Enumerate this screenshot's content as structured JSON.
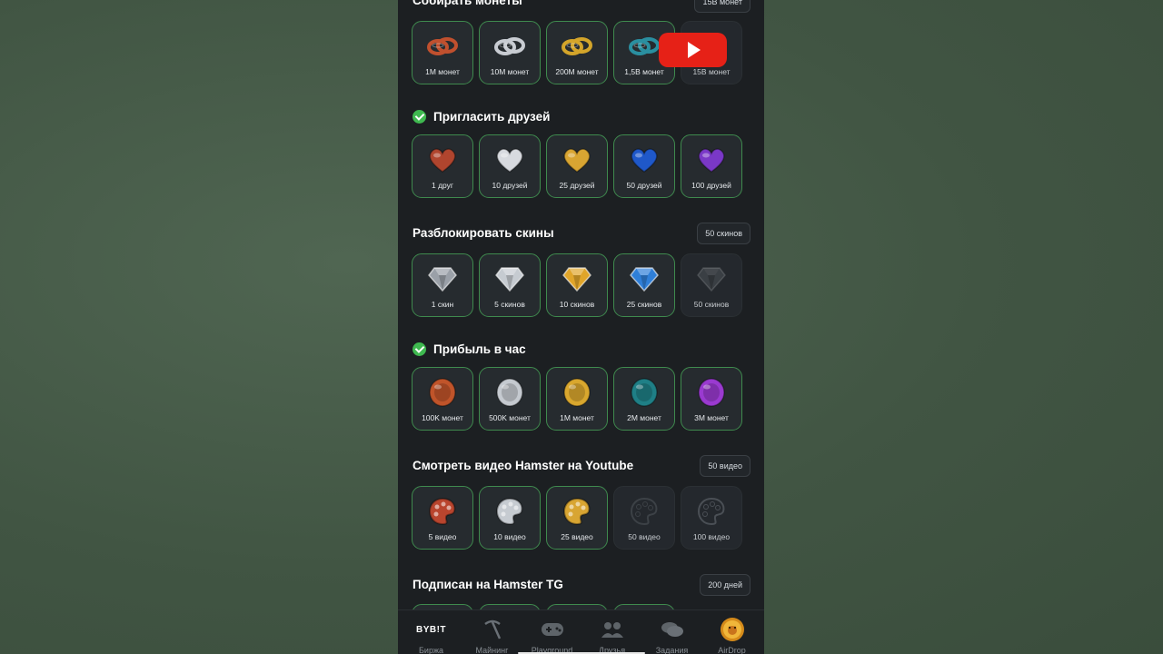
{
  "sections": {
    "coins": {
      "title": "Собирать монеты",
      "badge": "15B монет",
      "items": [
        {
          "label": "1M монет",
          "done": true,
          "color": "#c0502e",
          "icon": "rings-icon"
        },
        {
          "label": "10M монет",
          "done": true,
          "color": "#c8ccd2",
          "icon": "rings-icon"
        },
        {
          "label": "200M монет",
          "done": true,
          "color": "#d4a52a",
          "icon": "rings-icon"
        },
        {
          "label": "1,5B монет",
          "done": true,
          "color": "#2a8fa0",
          "icon": "rings-icon"
        },
        {
          "label": "15B монет",
          "done": false,
          "color": "#555a60",
          "icon": "rings-icon"
        }
      ]
    },
    "friends": {
      "title": "Пригласить друзей",
      "completed": true,
      "items": [
        {
          "label": "1 друг",
          "color": "#b0452e",
          "icon": "heart-icon"
        },
        {
          "label": "10 друзей",
          "color": "#d7dadf",
          "icon": "heart-icon"
        },
        {
          "label": "25 друзей",
          "color": "#d8a532",
          "icon": "heart-icon"
        },
        {
          "label": "50 друзей",
          "color": "#1f58c9",
          "icon": "heart-icon"
        },
        {
          "label": "100 друзей",
          "color": "#7a38c7",
          "icon": "heart-icon"
        }
      ]
    },
    "skins": {
      "title": "Разблокировать скины",
      "badge": "50 скинов",
      "items": [
        {
          "label": "1 скин",
          "done": true,
          "color": "#9aa0a8",
          "icon": "diamond-icon"
        },
        {
          "label": "5 скинов",
          "done": true,
          "color": "#c6cbd1",
          "icon": "diamond-icon"
        },
        {
          "label": "10 скинов",
          "done": true,
          "color": "#e0a52a",
          "icon": "diamond-icon"
        },
        {
          "label": "25 скинов",
          "done": true,
          "color": "#2f7fd8",
          "icon": "diamond-icon"
        },
        {
          "label": "50 скинов",
          "done": false,
          "color": "#3a3f44",
          "icon": "diamond-icon"
        }
      ]
    },
    "profit": {
      "title": "Прибыль в час",
      "completed": true,
      "items": [
        {
          "label": "100K монет",
          "color": "#c0542a",
          "icon": "coin-icon"
        },
        {
          "label": "500K монет",
          "color": "#c5cad0",
          "icon": "coin-icon"
        },
        {
          "label": "1M монет",
          "color": "#d9a72e",
          "icon": "coin-icon"
        },
        {
          "label": "2M монет",
          "color": "#1f7f86",
          "icon": "coin-icon"
        },
        {
          "label": "3M монет",
          "color": "#9a3ad0",
          "icon": "coin-icon"
        }
      ]
    },
    "youtube": {
      "title": "Смотреть видео Hamster на Youtube",
      "badge": "50 видео",
      "items": [
        {
          "label": "5 видео",
          "done": true,
          "color": "#b9452e",
          "icon": "palette-icon"
        },
        {
          "label": "10 видео",
          "done": true,
          "color": "#c6cbd1",
          "icon": "palette-icon"
        },
        {
          "label": "25 видео",
          "done": true,
          "color": "#d8a532",
          "icon": "palette-icon"
        },
        {
          "label": "50 видео",
          "done": false,
          "color": "#3c4146",
          "icon": "palette-icon"
        },
        {
          "label": "100 видео",
          "done": false,
          "color": "#4a4f55",
          "icon": "palette-icon"
        }
      ]
    },
    "tg": {
      "title": "Подписан на Hamster TG",
      "badge": "200 дней"
    }
  },
  "nav": {
    "items": [
      {
        "label": "Биржа",
        "icon": "bybit-logo",
        "logo_text": "BYB!T"
      },
      {
        "label": "Майнинг",
        "icon": "pickaxe-icon"
      },
      {
        "label": "Playground",
        "icon": "gamepad-icon"
      },
      {
        "label": "Друзья",
        "icon": "friends-icon"
      },
      {
        "label": "Задания",
        "icon": "coins-icon"
      },
      {
        "label": "AirDrop",
        "icon": "hamster-coin-icon"
      }
    ]
  },
  "colors": {
    "phone_bg": "#1c1f22",
    "done_border": "#3f8a4e",
    "check_green": "#3fb950",
    "youtube_red": "#e62117"
  }
}
